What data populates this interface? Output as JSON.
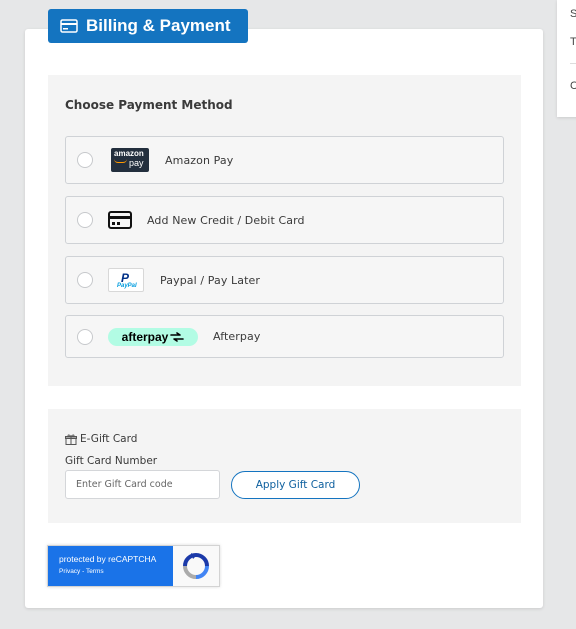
{
  "section": {
    "title": "Billing & Payment",
    "icon": "credit-card-icon"
  },
  "side_panel": {
    "line1": "S",
    "line2": "T",
    "line3": "C"
  },
  "payment": {
    "heading": "Choose Payment Method",
    "options": [
      {
        "label": "Amazon Pay",
        "logo_text_top": "amazon",
        "logo_text_bottom": "pay"
      },
      {
        "label": "Add New Credit / Debit Card",
        "icon": "credit-card-icon"
      },
      {
        "label": "Paypal / Pay Later",
        "logo_text_top": "P",
        "logo_text_bottom": "PayPal"
      },
      {
        "label": "Afterpay",
        "logo_text": "afterpay"
      }
    ]
  },
  "gift": {
    "title": "E-Gift Card",
    "icon": "gift-icon",
    "number_label": "Gift Card Number",
    "input_placeholder": "Enter Gift Card code",
    "input_value": "",
    "apply_label": "Apply Gift Card"
  },
  "recaptcha": {
    "text": "protected by reCAPTCHA",
    "links": "Privacy - Terms"
  },
  "colors": {
    "brand_blue": "#1474c0",
    "afterpay_mint": "#b2fce4",
    "amazon_dark": "#232f3e",
    "panel_bg": "#f4f4f4"
  }
}
